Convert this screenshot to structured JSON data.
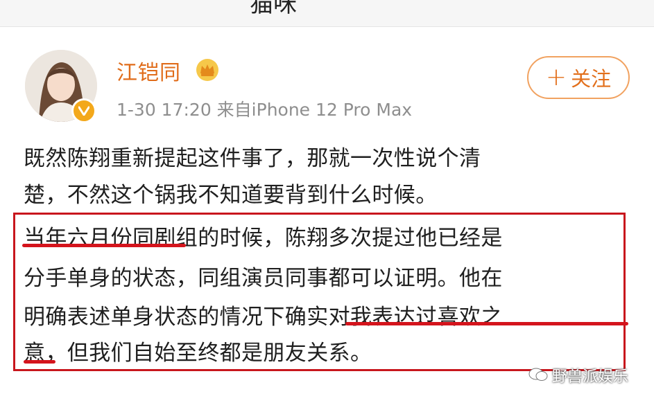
{
  "header": {
    "partial_title": "猫咪"
  },
  "profile": {
    "username": "江铠同",
    "meta": "1-30 17:20  来自iPhone 12 Pro Max",
    "follow_label": "关注",
    "follow_plus": "+"
  },
  "post": {
    "lines": [
      "既然陈翔重新提起这件事了，那就一次性说个清",
      "楚，不然这个锅我不知道要背到什么时候。",
      "当年六月份同剧组的时候，陈翔多次提过他已经是",
      "分手单身的状态，同组演员同事都可以证明。他在",
      "明确表述单身状态的情况下确实对我表达过喜欢之",
      "意，但我们自始至终都是朋友关系。"
    ]
  },
  "watermark": {
    "text": "野兽派娱乐"
  },
  "colors": {
    "username": "#e06c1a",
    "follow_border": "#f1a260",
    "highlight_red": "#c8161d",
    "verified_badge": "#f3a81b"
  }
}
